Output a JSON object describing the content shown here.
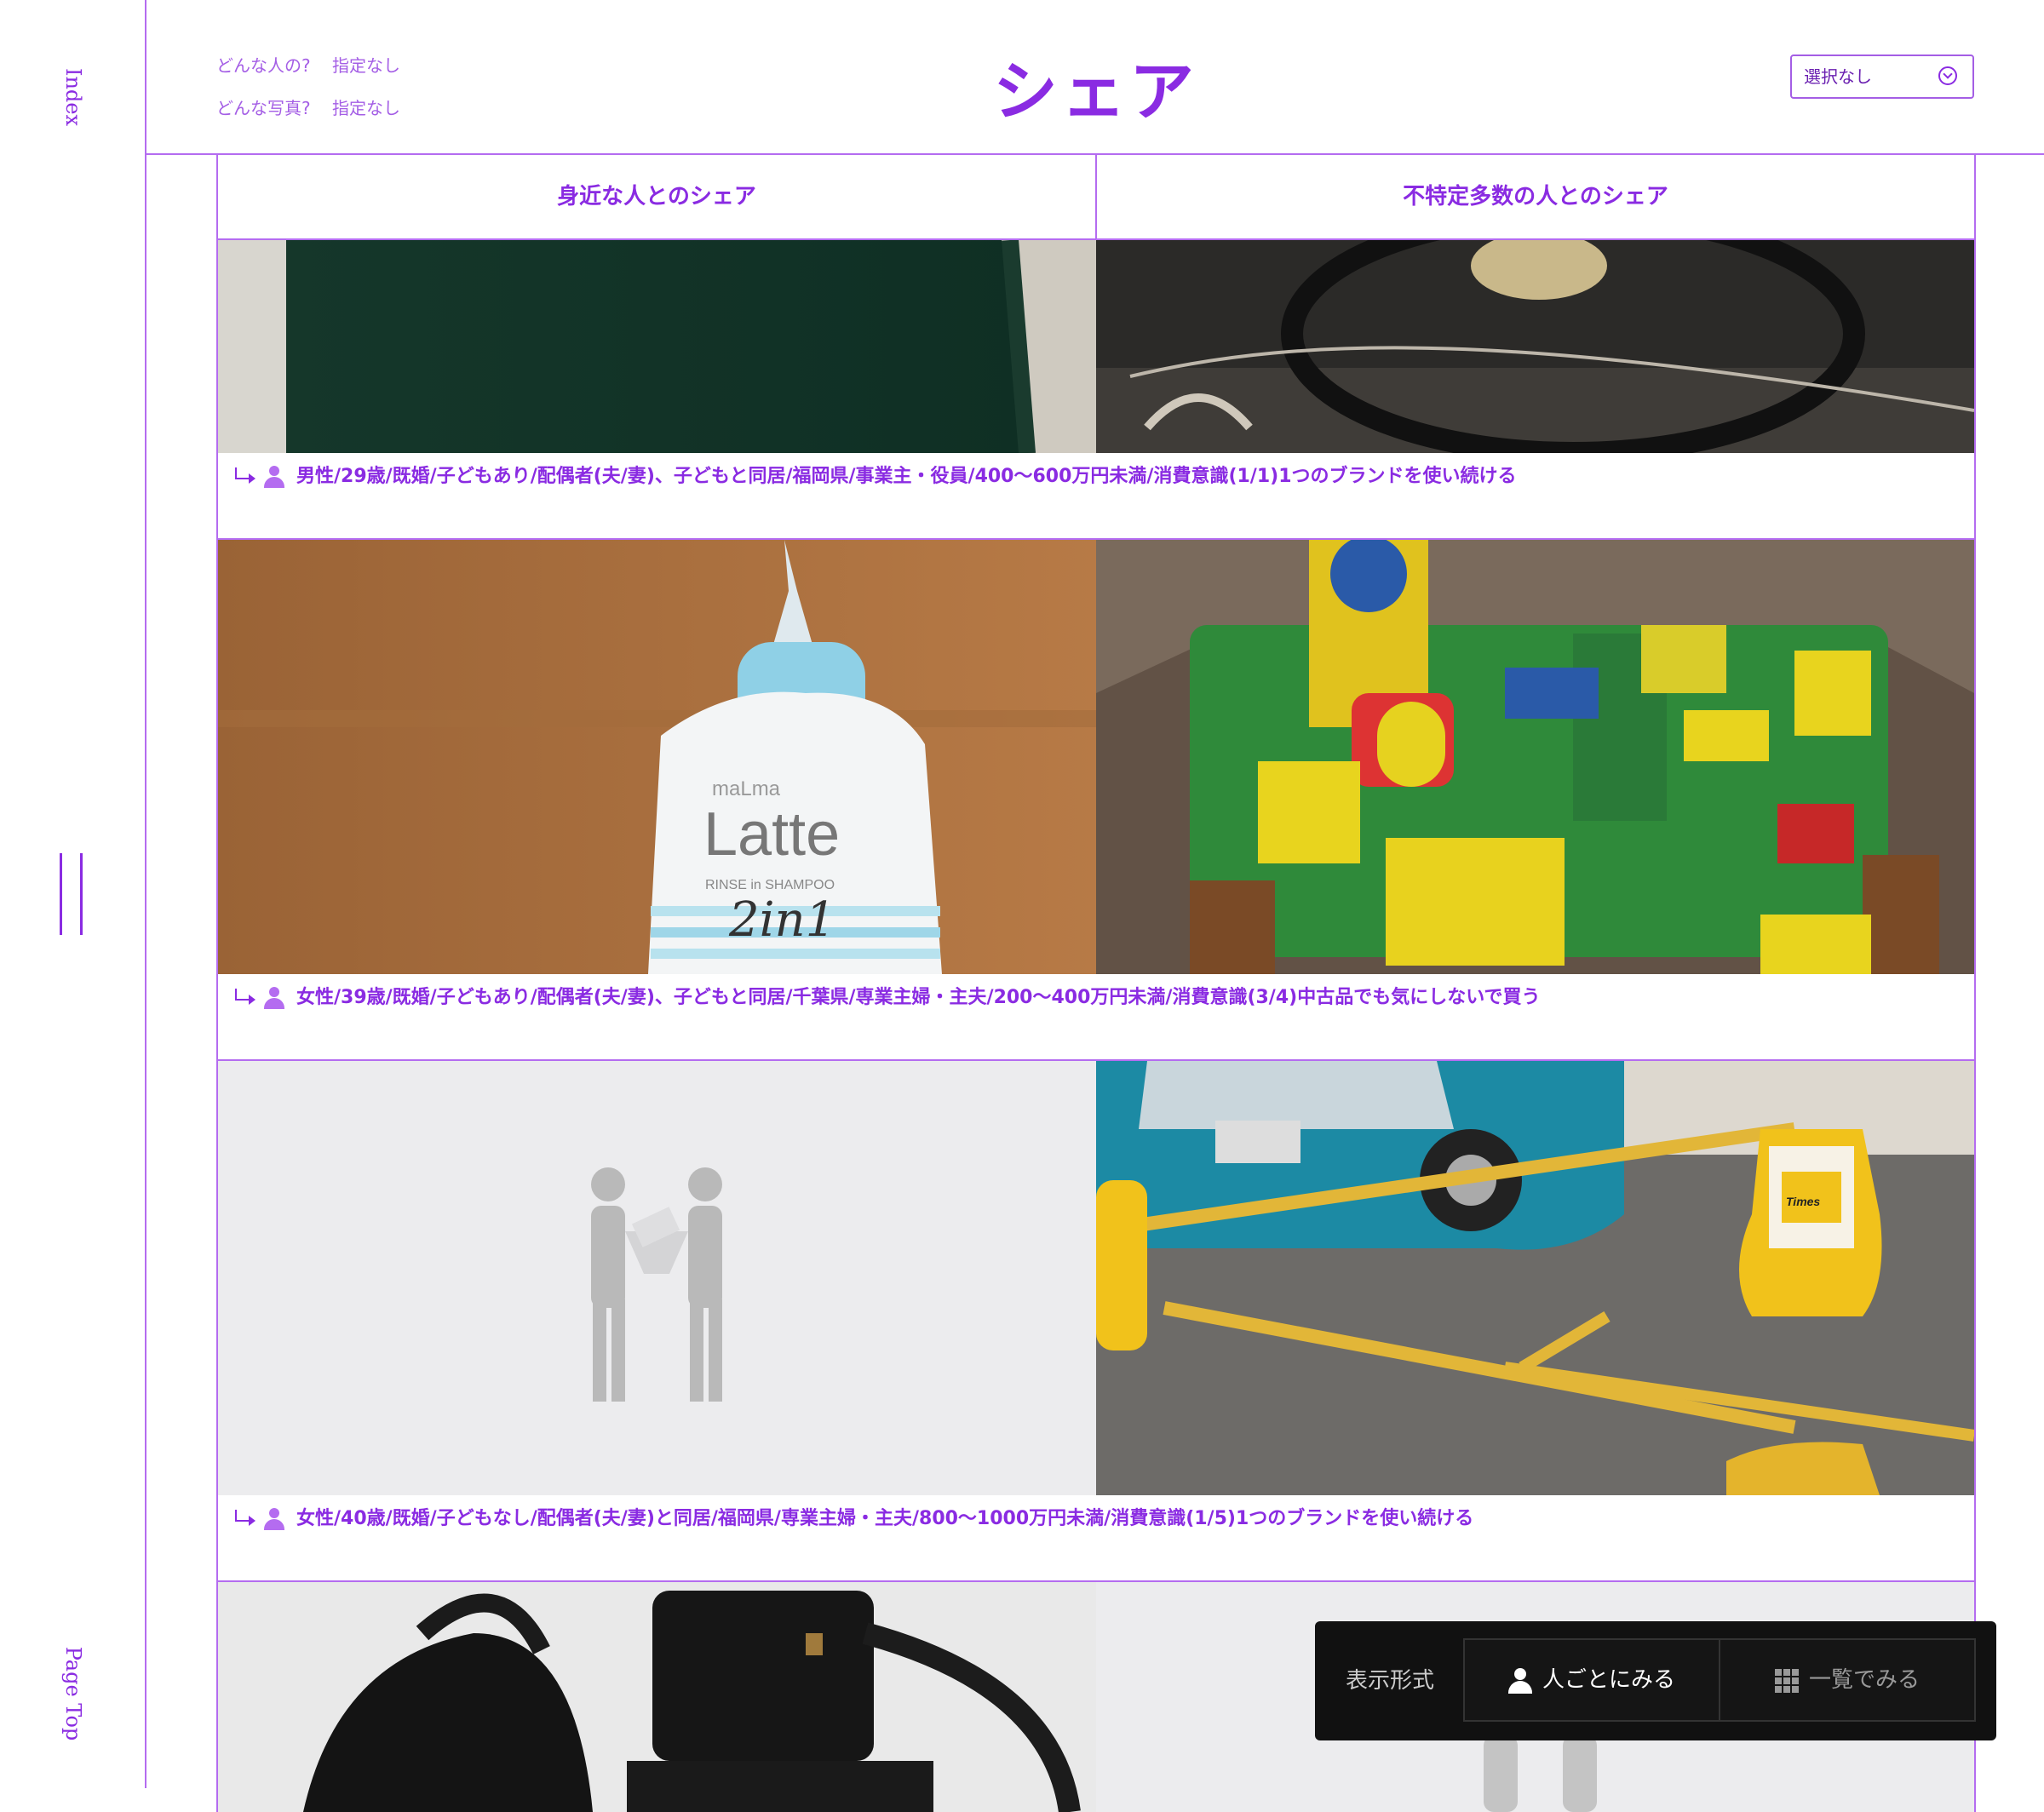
{
  "side": {
    "index": "Index",
    "page_top": "Page Top"
  },
  "header": {
    "title": "シェア",
    "filter_who_label": "どんな人の?",
    "filter_who_value": "指定なし",
    "filter_photo_label": "どんな写真?",
    "filter_photo_value": "指定なし",
    "select_value": "選択なし"
  },
  "columns": [
    "身近な人とのシェア",
    "不特定多数の人とのシェア"
  ],
  "rows": [
    {
      "caption": "男性/29歳/既婚/子どもあり/配偶者(夫/妻)、子どもと同居/福岡県/事業主・役員/400〜600万円未満/消費意識(1/1)1つのブランドを使い続ける"
    },
    {
      "caption": "女性/39歳/既婚/子どもあり/配偶者(夫/妻)、子どもと同居/千葉県/専業主婦・主夫/200〜400万円未満/消費意識(3/4)中古品でも気にしないで買う"
    },
    {
      "caption": "女性/40歳/既婚/子どもなし/配偶者(夫/妻)と同居/福岡県/専業主婦・主夫/800〜1000万円未満/消費意識(1/5)1つのブランドを使い続ける"
    }
  ],
  "photo_texts": {
    "latte_brand": "Latte",
    "latte_sub": "RINSE in SHAMPOO",
    "latte_2in1": "2in1",
    "times_sign": "Times"
  },
  "dock": {
    "label": "表示形式",
    "by_person": "人ごとにみる",
    "list": "一覧でみる"
  },
  "colors": {
    "accent": "#8a2be2",
    "border": "#b46cf0",
    "dock_bg": "#111111"
  }
}
